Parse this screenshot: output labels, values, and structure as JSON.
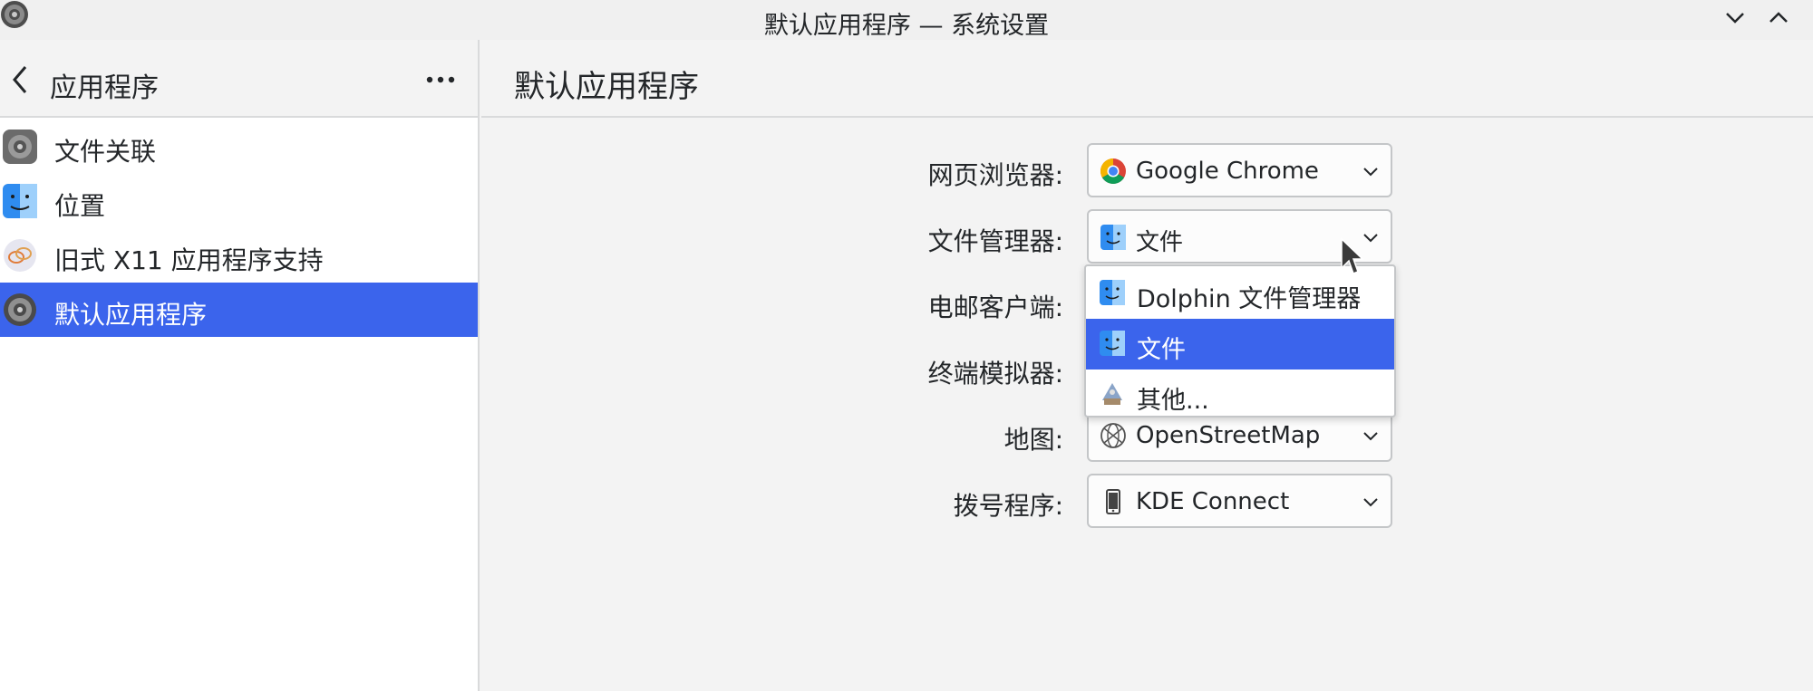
{
  "window": {
    "title": "默认应用程序 — 系统设置",
    "app_icon": "gear-icon"
  },
  "sidebar": {
    "title": "应用程序",
    "items": [
      {
        "label": "文件关联",
        "icon": "gear-icon",
        "selected": false
      },
      {
        "label": "位置",
        "icon": "finder-icon",
        "selected": false
      },
      {
        "label": "旧式 X11 应用程序支持",
        "icon": "x11-icon",
        "selected": false
      },
      {
        "label": "默认应用程序",
        "icon": "gear-icon",
        "selected": true
      }
    ]
  },
  "main": {
    "title": "默认应用程序",
    "rows": [
      {
        "label": "网页浏览器:",
        "value": "Google Chrome",
        "icon": "chrome-icon"
      },
      {
        "label": "文件管理器:",
        "value": "文件",
        "icon": "finder-icon"
      },
      {
        "label": "电邮客户端:",
        "value": "",
        "icon": ""
      },
      {
        "label": "终端模拟器:",
        "value": "",
        "icon": ""
      },
      {
        "label": "地图:",
        "value": "OpenStreetMap",
        "icon": "globe-icon"
      },
      {
        "label": "拨号程序:",
        "value": "KDE Connect",
        "icon": "phone-icon"
      }
    ],
    "dropdown": {
      "options": [
        {
          "label": "Dolphin 文件管理器",
          "icon": "finder-icon",
          "selected": false
        },
        {
          "label": "文件",
          "icon": "finder-icon",
          "selected": true
        },
        {
          "label": "其他...",
          "icon": "other-app-icon",
          "selected": false
        }
      ]
    }
  },
  "colors": {
    "accent": "#3b64ec",
    "background": "#f3f3f3",
    "sidebar_bg": "#ffffff",
    "border": "#d9dadb"
  }
}
